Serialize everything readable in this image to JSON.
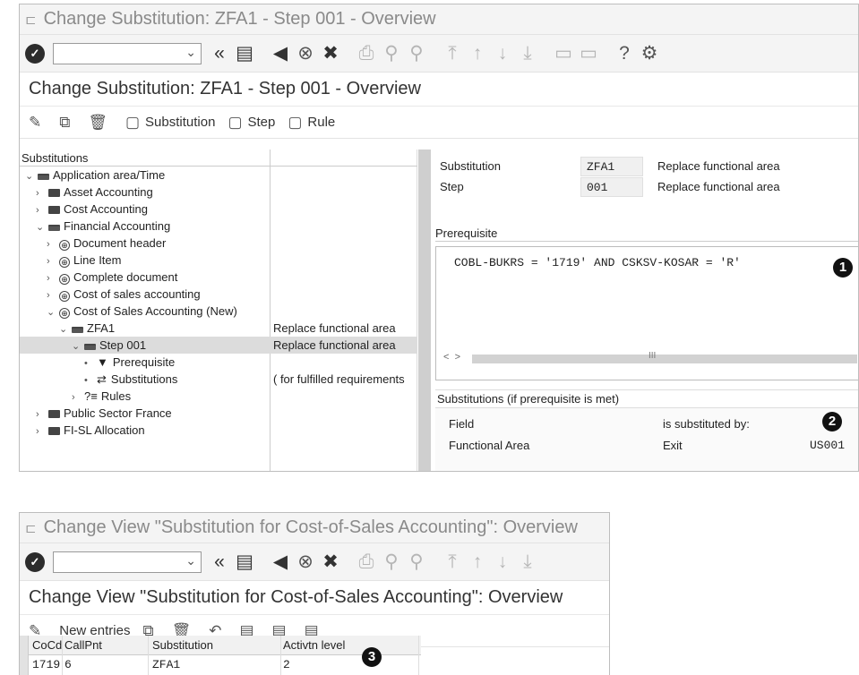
{
  "window1": {
    "title": "Change Substitution: ZFA1 - Step 001 - Overview",
    "page_title": "Change Substitution: ZFA1 - Step 001 - Overview",
    "app_toolbar": {
      "substitution": "Substitution",
      "step": "Step",
      "rule": "Rule"
    },
    "tree": {
      "header": "Substitutions",
      "rows": [
        {
          "label": "Application area/Time",
          "desc": ""
        },
        {
          "label": "Asset Accounting",
          "desc": ""
        },
        {
          "label": "Cost Accounting",
          "desc": ""
        },
        {
          "label": "Financial Accounting",
          "desc": ""
        },
        {
          "label": "Document header",
          "desc": ""
        },
        {
          "label": "Line Item",
          "desc": ""
        },
        {
          "label": "Complete document",
          "desc": ""
        },
        {
          "label": "Cost of sales accounting",
          "desc": ""
        },
        {
          "label": "Cost of Sales Accounting (New)",
          "desc": ""
        },
        {
          "label": "ZFA1",
          "desc": "Replace functional area"
        },
        {
          "label": "Step 001",
          "desc": "Replace functional area"
        },
        {
          "label": "Prerequisite",
          "desc": ""
        },
        {
          "label": "Substitutions",
          "desc": "( for fulfilled requirements"
        },
        {
          "label": "Rules",
          "desc": ""
        },
        {
          "label": "Public Sector France",
          "desc": ""
        },
        {
          "label": "FI-SL Allocation",
          "desc": ""
        }
      ]
    },
    "detail": {
      "substitution_label": "Substitution",
      "substitution_value": "ZFA1",
      "substitution_desc": "Replace functional area",
      "step_label": "Step",
      "step_value": "001",
      "step_desc": "Replace functional area",
      "prerequisite_title": "Prerequisite",
      "prerequisite_code": "COBL-BUKRS = '1719' AND CSKSV-KOSAR = 'R'",
      "scroll_left": "<",
      "scroll_right": ">",
      "scroll_thumb": "III",
      "subs_title": "Substitutions (if prerequisite is met)",
      "col_field": "Field",
      "col_subst": "is substituted by:",
      "row_field": "Functional Area",
      "row_type": "Exit",
      "row_value": "US001"
    },
    "badges": {
      "one": "1",
      "two": "2"
    }
  },
  "window2": {
    "title": "Change View \"Substitution for Cost-of-Sales Accounting\": Overview",
    "page_title": "Change View \"Substitution for Cost-of-Sales Accounting\": Overview",
    "new_entries": "New entries",
    "grid": {
      "headers": [
        "CoCd",
        "CallPnt",
        "Substitution",
        "Activtn level"
      ],
      "rows": [
        [
          "1719",
          "6",
          "ZFA1",
          "2"
        ]
      ]
    },
    "badge": "3"
  }
}
